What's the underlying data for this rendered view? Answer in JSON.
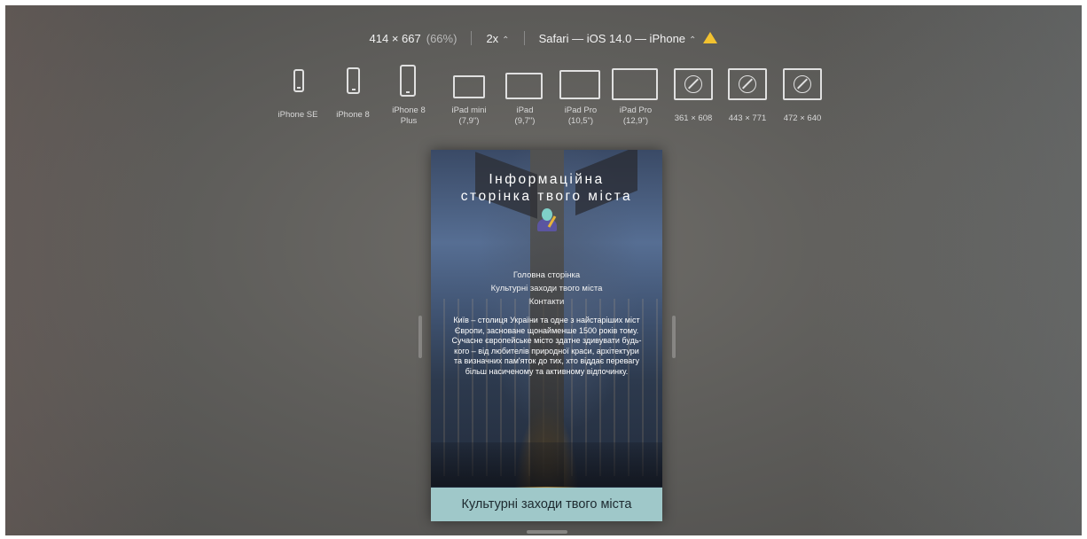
{
  "toolbar": {
    "size_text": "414 × 667",
    "zoom_text": "(66%)",
    "scale_text": "2x",
    "scale_chevron": "⌃",
    "browser_text": "Safari — iOS 14.0 — iPhone",
    "browser_chevron": "⌃",
    "warning_icon": "warning-triangle-icon",
    "warning_color": "#f2c230"
  },
  "devices": [
    {
      "label": "iPhone SE",
      "icon": "phone-icon"
    },
    {
      "label": "iPhone 8",
      "icon": "phone-icon"
    },
    {
      "label": "iPhone 8 Plus",
      "icon": "phone-icon"
    },
    {
      "label": "iPad mini (7,9\")",
      "icon": "tablet-icon"
    },
    {
      "label": "iPad (9,7\")",
      "icon": "tablet-icon"
    },
    {
      "label": "iPad Pro (10,5\")",
      "icon": "tablet-icon"
    },
    {
      "label": "iPad Pro (12,9\")",
      "icon": "tablet-icon"
    },
    {
      "label": "361 × 608",
      "icon": "safari-compass-icon"
    },
    {
      "label": "443 × 771",
      "icon": "safari-compass-icon"
    },
    {
      "label": "472 × 640",
      "icon": "safari-compass-icon"
    }
  ],
  "page": {
    "title_line1": "Інформаційна",
    "title_line2": "сторінка твого міста",
    "avatar_icon": "teacher-emoji-icon",
    "nav": [
      "Головна сторінка",
      "Культурні заходи твого міста",
      "Контакти"
    ],
    "description": "Київ – столиця України та одне з найстаріших міст Європи, засноване щонайменше 1500 років тому. Сучасне європейське місто здатне здивувати будь-кого – від любителів природної краси, архітектури та визначних пам'яток до тих, хто віддає перевагу більш насиченому та активному відпочинку.",
    "cta_label": "Культурні заходи твого міста",
    "cta_color": "#9fc8c9"
  }
}
